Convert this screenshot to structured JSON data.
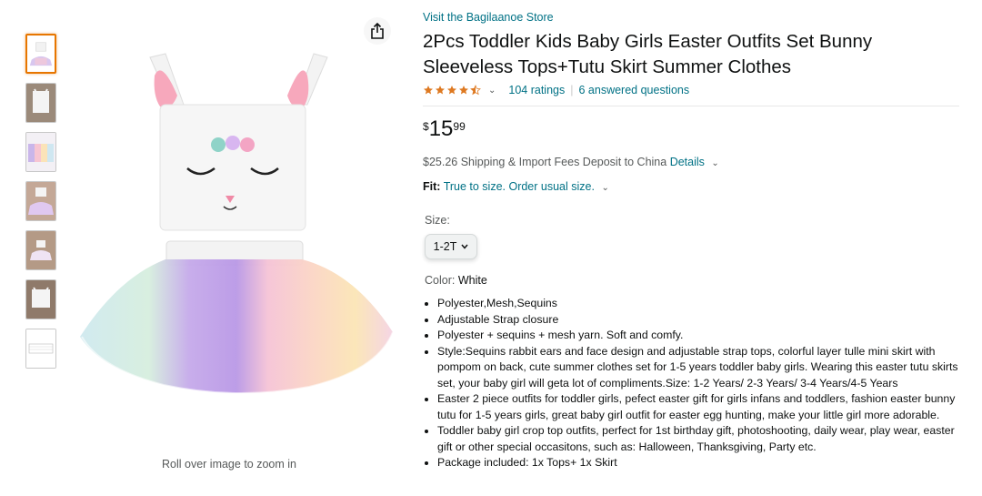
{
  "gallery": {
    "thumbnail_count": 7,
    "share_icon": "share-icon",
    "zoom_hint": "Roll over image to zoom in"
  },
  "product": {
    "store_link": "Visit the Bagilaanoe Store",
    "title": "2Pcs Toddler Kids Baby Girls Easter Outfits Set Bunny Sleeveless Tops+Tutu Skirt Summer Clothes",
    "rating_stars": 4.5,
    "ratings_link": "104 ratings",
    "separator": "|",
    "questions_link": "6 answered questions",
    "price": {
      "symbol": "$",
      "whole": "15",
      "fraction": "99"
    },
    "shipping": {
      "text": "$25.26 Shipping & Import Fees Deposit to China",
      "details_link": "Details"
    },
    "fit": {
      "label": "Fit:",
      "value": "True to size. Order usual size."
    },
    "size": {
      "label": "Size:",
      "selected": "1-2T"
    },
    "color": {
      "label": "Color: ",
      "value": "White"
    },
    "bullets": [
      "Polyester,Mesh,Sequins",
      "Adjustable Strap closure",
      "Polyester + sequins + mesh yarn. Soft and comfy.",
      "Style:Sequins rabbit ears and face design and adjustable strap tops, colorful layer tulle mini skirt with pompom on back, cute summer clothes set for 1-5 years toddler baby girls. Wearing this easter tutu skirts set, your baby girl will geta lot of compliments.Size: 1-2 Years/ 2-3 Years/ 3-4 Years/4-5 Years",
      "Easter 2 piece outfits for toddler girls, pefect easter gift for girls infans and toddlers, fashion easter bunny tutu for 1-5 years girls, great baby girl outfit for easter egg hunting, make your little girl more adorable.",
      "Toddler baby girl crop top outfits, perfect for 1st birthday gift, photoshooting, daily wear, play wear, easter gift or other special occasitons, such as: Halloween, Thanksgiving, Party etc.",
      "Package included: 1x Tops+ 1x Skirt"
    ]
  },
  "colors": {
    "link": "#007185",
    "star": "#de7921",
    "thumb_active_border": "#e77600",
    "text": "#0f1111",
    "muted": "#565959"
  }
}
